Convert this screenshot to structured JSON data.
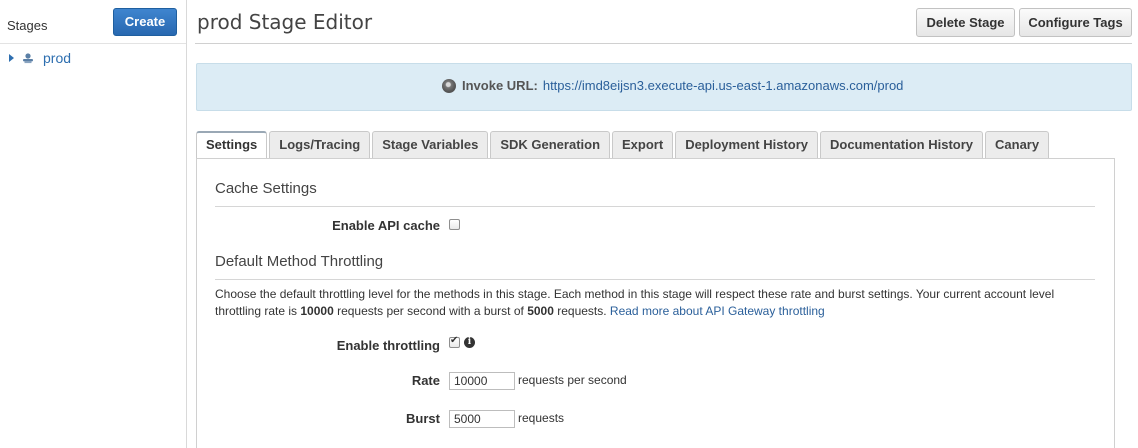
{
  "sidebar": {
    "title": "Stages",
    "create_label": "Create",
    "items": [
      {
        "label": "prod"
      }
    ]
  },
  "header": {
    "title": "prod Stage Editor",
    "delete_label": "Delete Stage",
    "tags_label": "Configure Tags"
  },
  "invoke": {
    "label": "Invoke URL:",
    "url": "https://imd8eijsn3.execute-api.us-east-1.amazonaws.com/prod"
  },
  "tabs": [
    {
      "label": "Settings",
      "active": true
    },
    {
      "label": "Logs/Tracing"
    },
    {
      "label": "Stage Variables"
    },
    {
      "label": "SDK Generation"
    },
    {
      "label": "Export"
    },
    {
      "label": "Deployment History"
    },
    {
      "label": "Documentation History"
    },
    {
      "label": "Canary"
    }
  ],
  "cache": {
    "section_title": "Cache Settings",
    "enable_label": "Enable API cache",
    "enabled": false
  },
  "throttling": {
    "section_title": "Default Method Throttling",
    "desc_part1": "Choose the default throttling level for the methods in this stage. Each method in this stage will respect these rate and burst settings. Your current account level throttling rate is ",
    "rate_limit": "10000",
    "desc_part2": " requests per second with a burst of ",
    "burst_limit": "5000",
    "desc_part3": " requests. ",
    "link": "Read more about API Gateway throttling",
    "enable_label": "Enable throttling",
    "enabled": true,
    "rate_label": "Rate",
    "rate_value": "10000",
    "rate_unit": "requests per second",
    "burst_label": "Burst",
    "burst_value": "5000",
    "burst_unit": "requests"
  }
}
